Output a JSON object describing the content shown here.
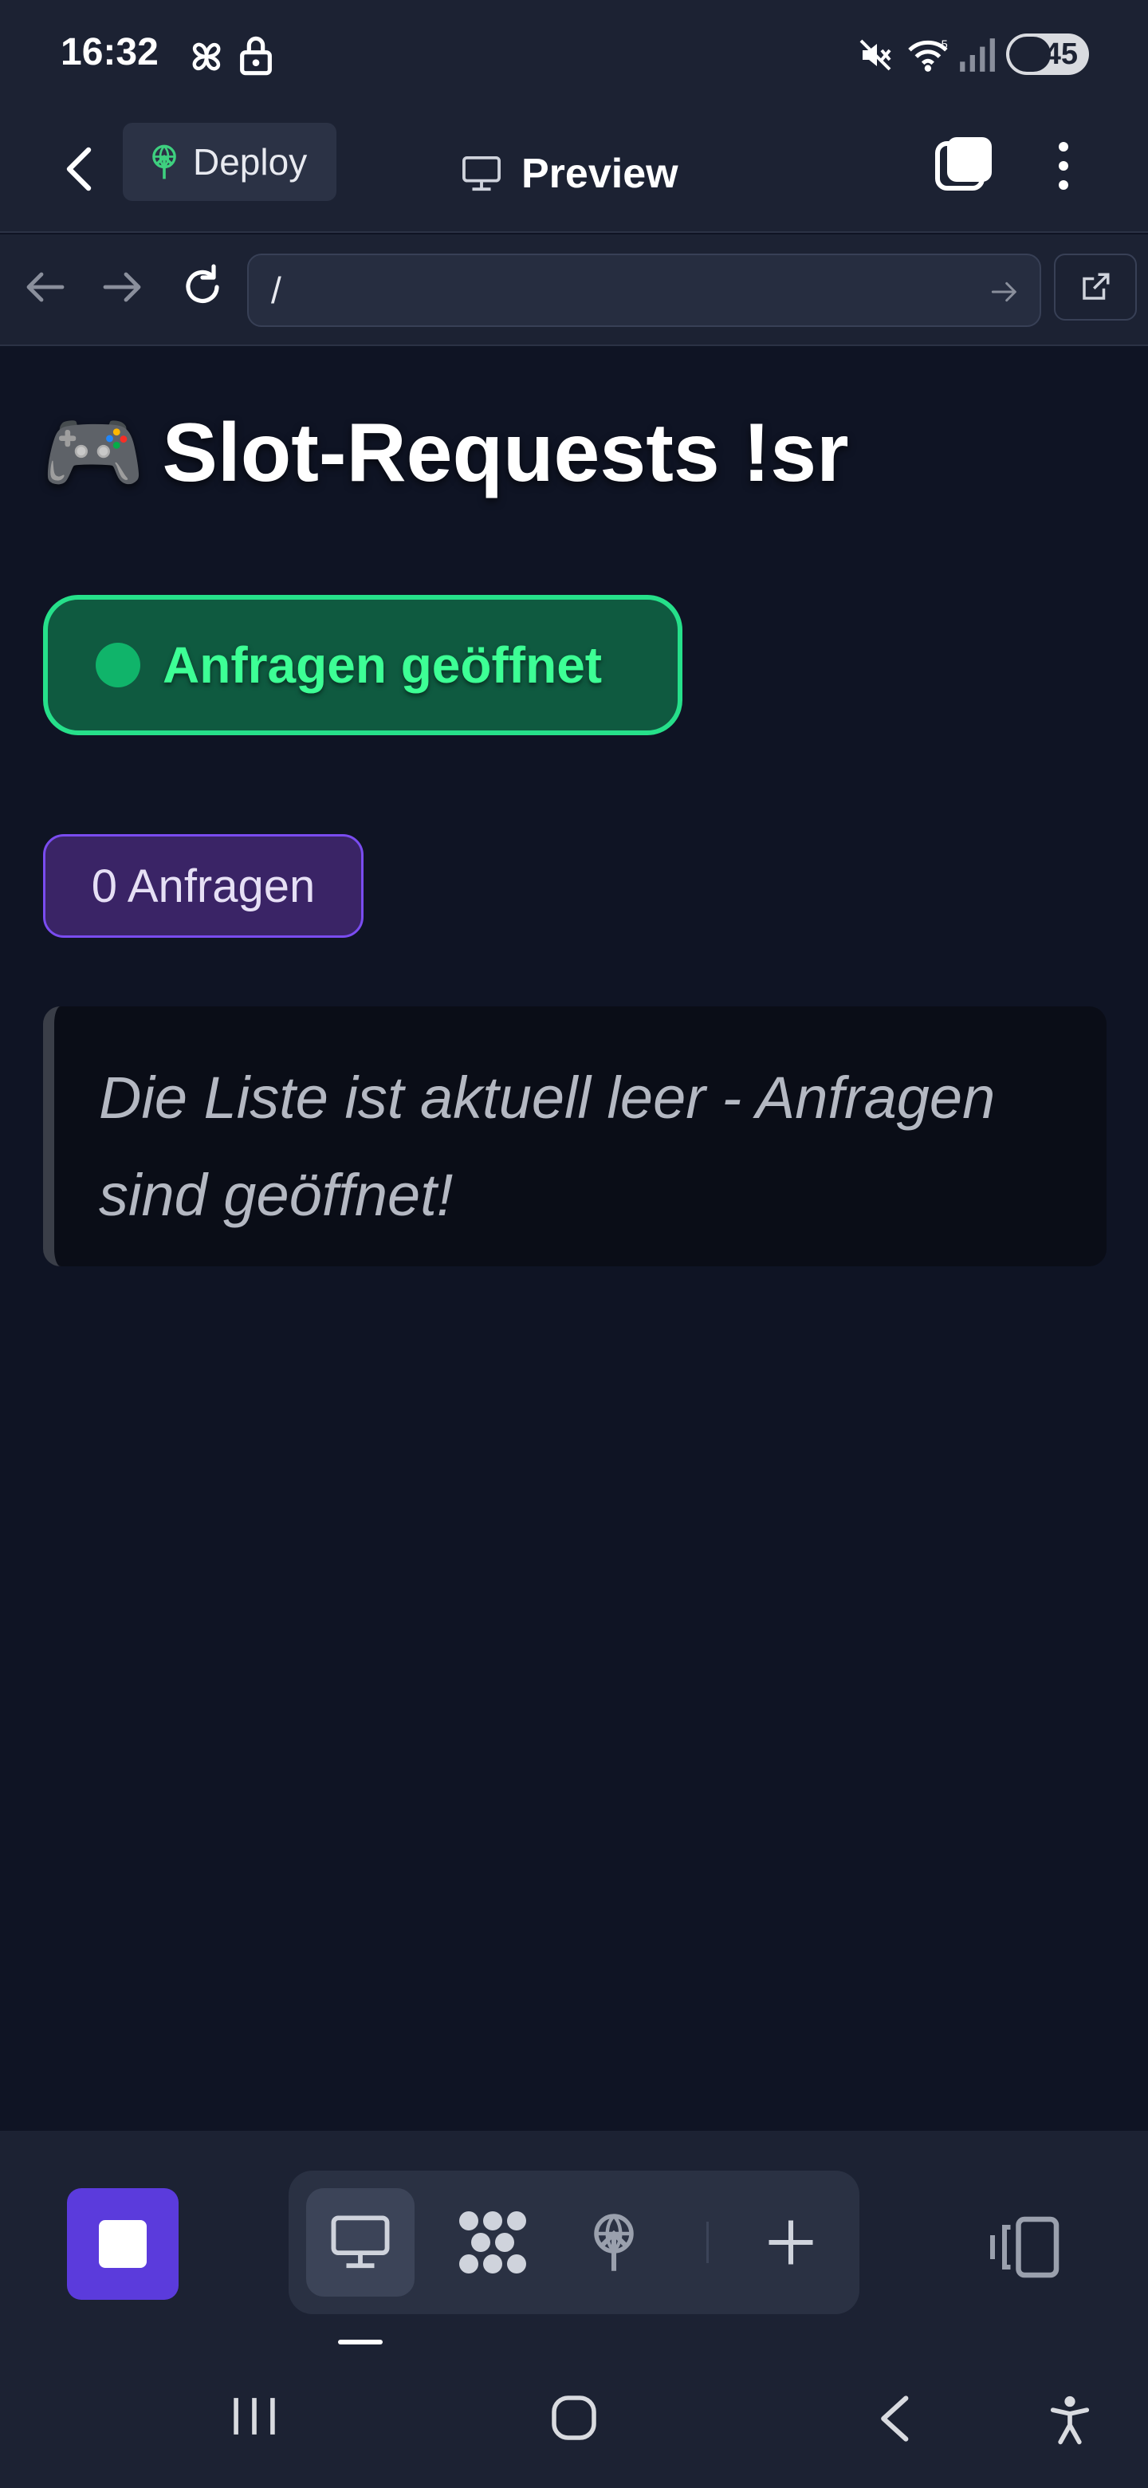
{
  "status_bar": {
    "time": "16:32",
    "battery_level": "45",
    "icons": [
      "pinwheel-icon",
      "lock-icon",
      "mute-icon",
      "wifi-icon",
      "signal-icon",
      "battery-icon"
    ]
  },
  "header": {
    "deploy_label": "Deploy",
    "title": "Preview"
  },
  "url_bar": {
    "value": "/"
  },
  "page": {
    "title_emoji": "🎮",
    "title": "Slot-Requests !sr",
    "status_label": "Anfragen geöffnet",
    "count_label": "0 Anfragen",
    "empty_message": "Die Liste ist aktuell leer - Anfragen sind geöffnet!"
  },
  "toolbar": {
    "items": [
      "stop-icon",
      "monitor-icon",
      "apps-grid-icon",
      "deploy-icon",
      "plus-icon",
      "layout-icon"
    ]
  },
  "colors": {
    "background": "#0f1424",
    "bar": "#1c2233",
    "status_green": "#3dff95",
    "status_border": "#26e08a",
    "badge_purple": "#7a4cf0",
    "stop_button": "#5b3bdc"
  }
}
